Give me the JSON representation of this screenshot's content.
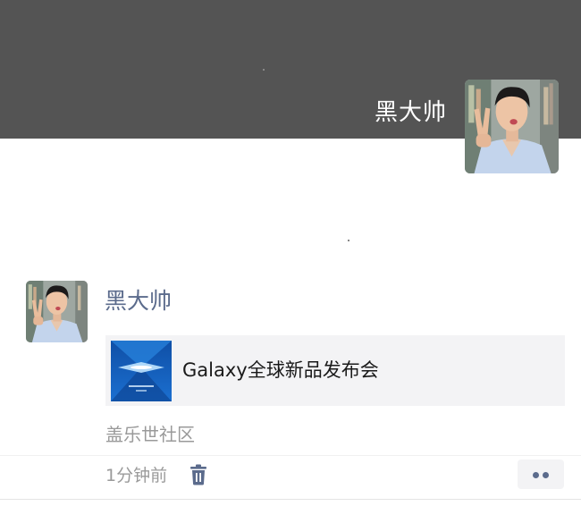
{
  "cover": {
    "background_color": "#545454",
    "user_name": "黑大帅",
    "avatar_icon": "user-avatar-photo"
  },
  "post": {
    "user_name": "黑大帅",
    "avatar_icon": "user-avatar-photo",
    "link_card": {
      "title": "Galaxy全球新品发布会",
      "thumbnail_icon": "galaxy-event-thumbnail"
    },
    "location": "盖乐世社区",
    "time": "1分钟前",
    "delete_icon": "trash-icon",
    "more_icon": "more-dots-icon"
  },
  "colors": {
    "name_link": "#5b6b8c",
    "secondary_text": "#9a9a9a",
    "card_background": "#f3f3f5"
  }
}
